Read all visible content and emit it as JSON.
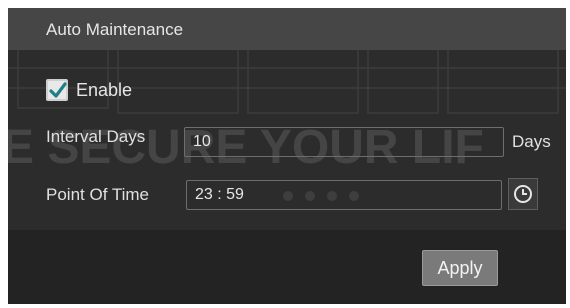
{
  "dialog": {
    "title": "Auto Maintenance"
  },
  "enable": {
    "label": "Enable",
    "checked": true
  },
  "interval": {
    "label": "Interval Days",
    "value": "10",
    "unit": "Days"
  },
  "point_of_time": {
    "label": "Point Of Time",
    "value": "23 : 59",
    "icon": "clock-icon"
  },
  "apply": {
    "label": "Apply"
  },
  "watermark": {
    "text": "E SECURE YOUR LIF"
  },
  "colors": {
    "checkbox_accent": "#1f7f86",
    "panel": "#2c2c2c",
    "title_bar": "#464646",
    "footer": "#232323",
    "button": "#7a7a7a"
  }
}
